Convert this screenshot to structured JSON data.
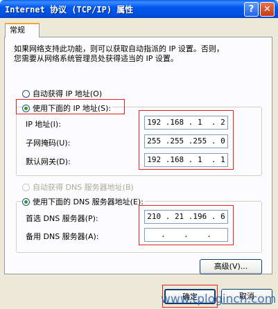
{
  "window": {
    "title": "Internet 协议 (TCP/IP) 属性"
  },
  "titlebar_buttons": {
    "help": "?",
    "close": "✕"
  },
  "tabs": [
    {
      "label": "常规"
    }
  ],
  "intro_lines": [
    "如果网络支持此功能，则可以获取自动指派的 IP 设置。否则，",
    "您需要从网络系统管理员处获得适当的 IP 设置。"
  ],
  "ip_section": {
    "auto_label": "自动获得 IP 地址(O)",
    "manual_label": "使用下面的 IP 地址(S):",
    "selected": "manual",
    "fields": [
      {
        "label": "IP 地址(I):",
        "value": "192 .168 . 1  . 2"
      },
      {
        "label": "子网掩码(U):",
        "value": "255 .255 .255 . 0"
      },
      {
        "label": "默认网关(D):",
        "value": "192 .168 . 1  . 1"
      }
    ]
  },
  "dns_section": {
    "auto_label": "自动获得 DNS 服务器地址(B)",
    "manual_label": "使用下面的 DNS 服务器地址(E):",
    "selected": "manual",
    "fields": [
      {
        "label": "首选 DNS 服务器(P):",
        "value": "210 . 21 .196 . 6"
      },
      {
        "label": "备用 DNS 服务器(A):",
        "value": "   .    .    .   "
      }
    ]
  },
  "buttons": {
    "advanced": "高级(V)...",
    "ok": "确定",
    "cancel": "取消"
  },
  "watermark": "www.tplogincn.com",
  "colors": {
    "highlight_frame": "#e4201a",
    "titlebar": "#0058ee",
    "selected_radio": "#21a121"
  }
}
